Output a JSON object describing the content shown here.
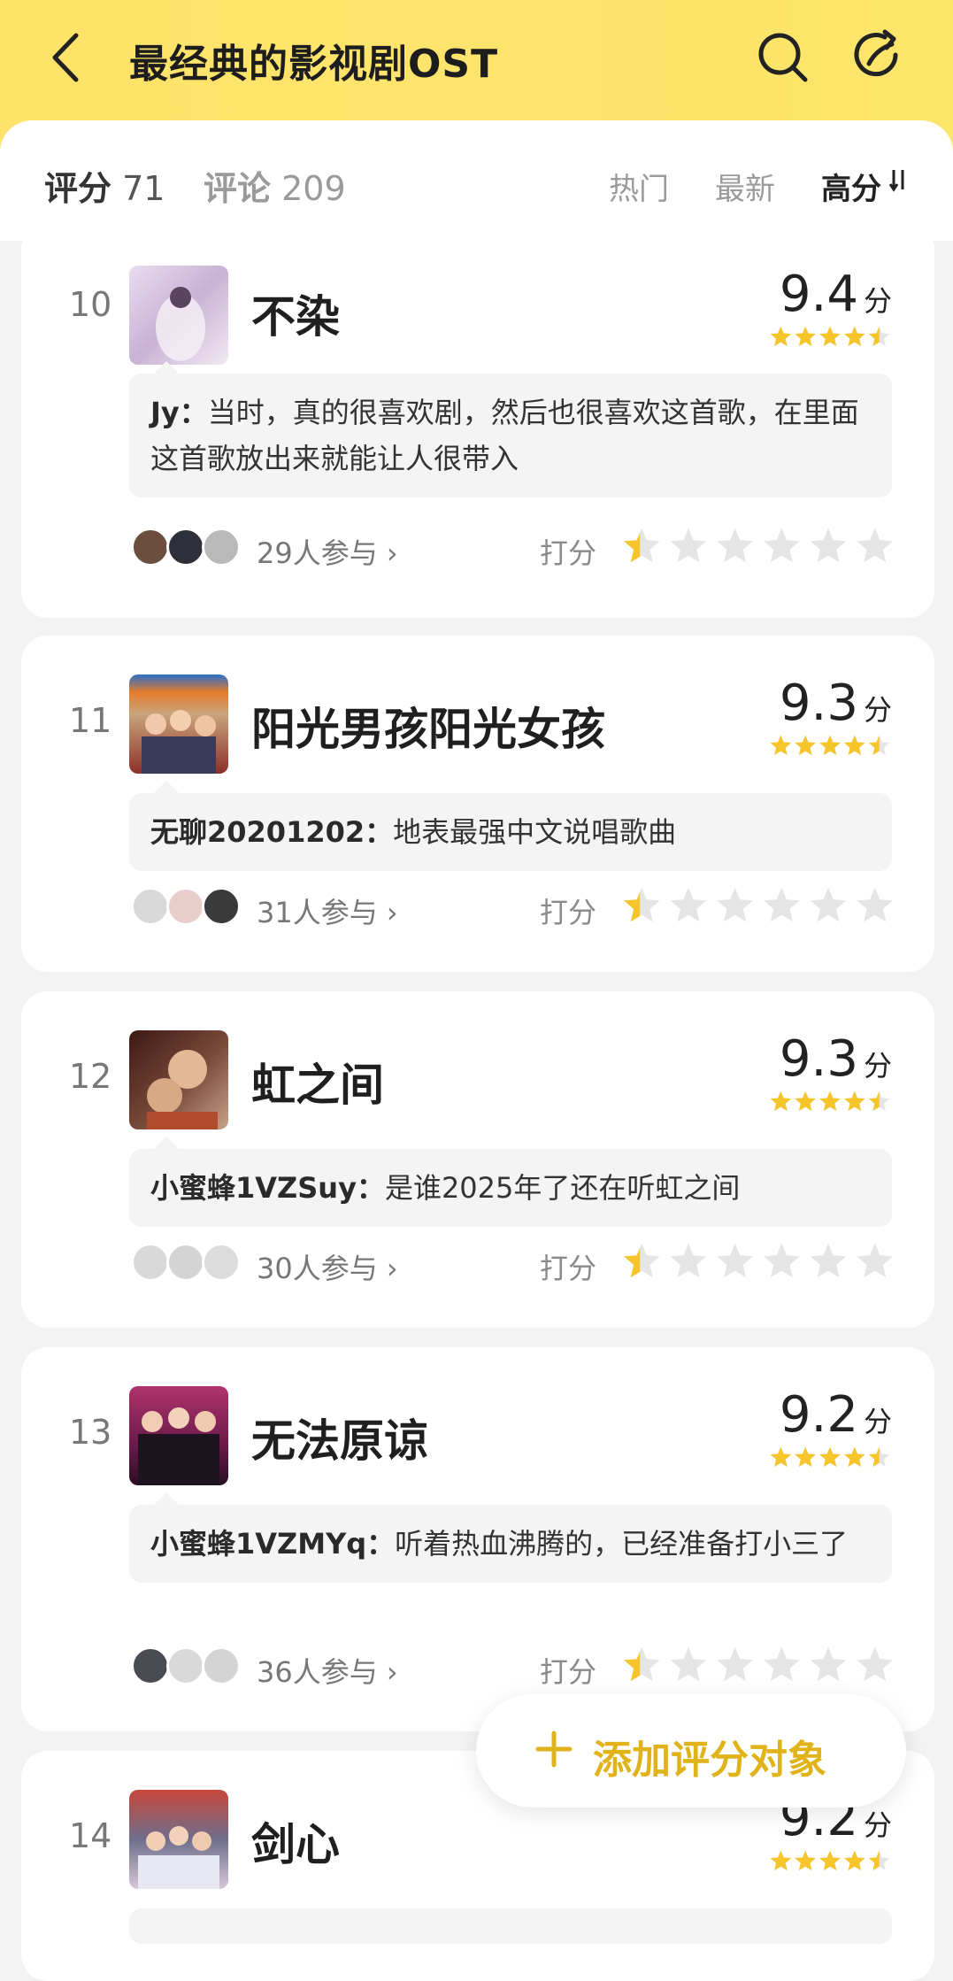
{
  "header": {
    "title": "最经典的影视剧OST"
  },
  "tabs": {
    "rating_label": "评分",
    "rating_count": "71",
    "comment_label": "评论",
    "comment_count": "209",
    "sort_options": [
      "热门",
      "最新",
      "高分"
    ],
    "active_sort": "高分"
  },
  "colors": {
    "header_bg": "#fde36a",
    "star": "#f5c52a",
    "star_empty": "#e5e5e5",
    "accent": "#e1b31b"
  },
  "items": [
    {
      "rank": "10",
      "name": "不染",
      "score": "9.4",
      "unit": "分",
      "comment_user": "Jy：",
      "comment_text": "当时，真的很喜欢剧，然后也很喜欢这首歌，在里面这首歌放出来就能让人很带入",
      "participants": "29人参与",
      "rate_label": "打分"
    },
    {
      "rank": "11",
      "name": "阳光男孩阳光女孩",
      "score": "9.3",
      "unit": "分",
      "comment_user": "无聊20201202：",
      "comment_text": "地表最强中文说唱歌曲",
      "participants": "31人参与",
      "rate_label": "打分"
    },
    {
      "rank": "12",
      "name": "虹之间",
      "score": "9.3",
      "unit": "分",
      "comment_user": "小蜜蜂1VZSuy：",
      "comment_text": "是谁2025年了还在听虹之间",
      "participants": "30人参与",
      "rate_label": "打分"
    },
    {
      "rank": "13",
      "name": "无法原谅",
      "score": "9.2",
      "unit": "分",
      "comment_user": "小蜜蜂1VZMYq：",
      "comment_text": "听着热血沸腾的，已经准备打小三了",
      "participants": "36人参与",
      "rate_label": "打分"
    },
    {
      "rank": "14",
      "name": "剑心",
      "score": "9.2",
      "unit": "分"
    }
  ],
  "add_button": {
    "label": "添加评分对象"
  }
}
